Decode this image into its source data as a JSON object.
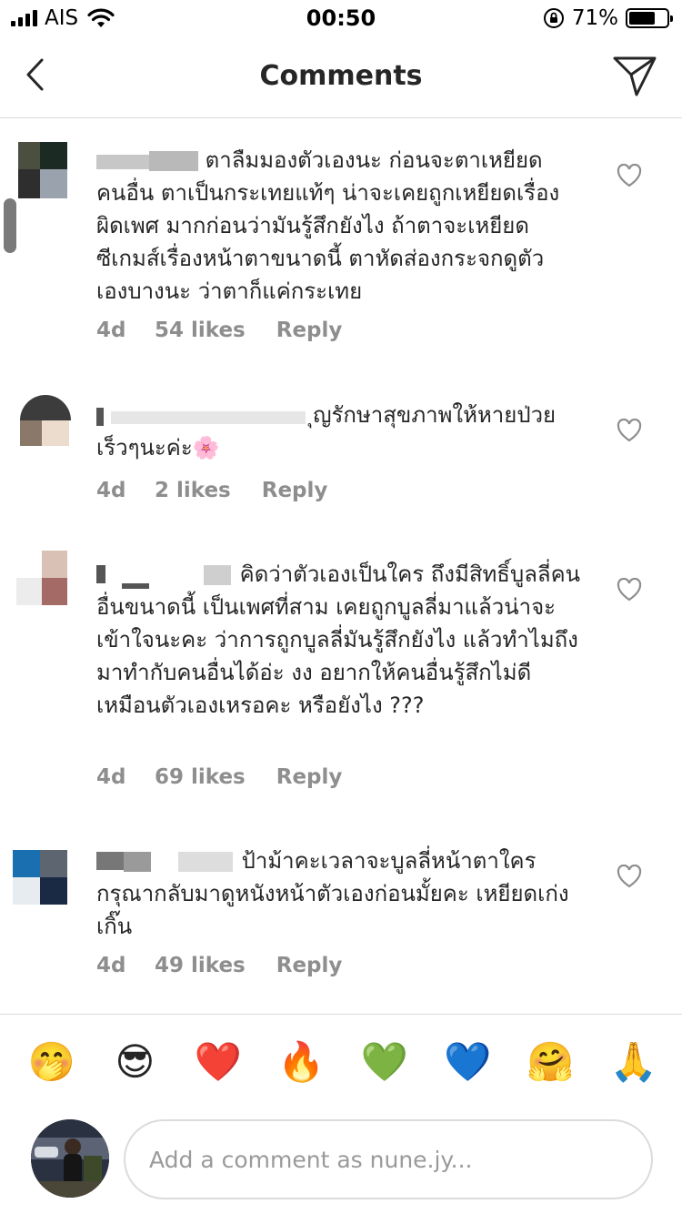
{
  "status_bar": {
    "carrier": "AIS",
    "time": "00:50",
    "battery_percent": "71%",
    "battery_level": 0.71
  },
  "header": {
    "title": "Comments",
    "back_icon": "chevron-left-icon",
    "send_icon": "paper-plane-icon"
  },
  "comments": [
    {
      "text": "ตาลืมมองตัวเองนะ ก่อนจะตาเหยียดคนอื่น ตาเป็นกระเทยแท้ๆ น่าจะเคยถูกเหยียดเรื่องผิดเพศ มากก่อนว่ามันรู้สึกยังไง  ถ้าตาจะเหยียดซีเกมส์เรื่องหน้าตาขนาดนี้ ตาหัดส่องกระจกดูตัวเองบางนะ ว่าตาก็แค่กระเทย",
      "age": "4d",
      "likes": "54 likes",
      "reply": "Reply"
    },
    {
      "text": "ุญรักษาสุขภาพให้หายป่วยเร็วๆนะค่ะ🌸",
      "age": "4d",
      "likes": "2 likes",
      "reply": "Reply"
    },
    {
      "text": "คิดว่าตัวเองเป็นใคร ถึงมีสิทธิ์บูลลี่คนอื่นขนาดนี้ เป็นเพศที่สาม เคยถูกบูลลี่มาแล้วน่าจะเข้าใจนะคะ ว่าการถูกบูลลี่มันรู้สึกยังไง แล้วทำไมถึงมาทำกับคนอื่นได้อ่ะ งง อยากให้คนอื่นรู้สึกไม่ดีเหมือนตัวเองเหรอคะ หรือยังไง ???",
      "age": "4d",
      "likes": "69 likes",
      "reply": "Reply"
    },
    {
      "text": "ป้าม้าคะเวลาจะบูลลี่หน้าตาใคร กรุณากลับมาดูหนังหน้าตัวเองก่อนมั้ยคะ เหยียดเก่งเกิ๊น",
      "age": "4d",
      "likes": "49 likes",
      "reply": "Reply"
    }
  ],
  "emoji_bar": [
    "🤭",
    "😎",
    "❤️",
    "🔥",
    "💚",
    "💙",
    "🤗",
    "🙏"
  ],
  "composer": {
    "placeholder": "Add a comment as nune.jy..."
  }
}
